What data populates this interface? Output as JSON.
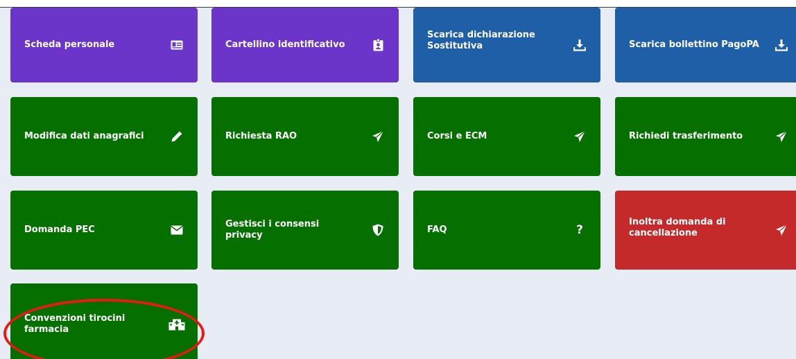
{
  "tiles": [
    {
      "id": "scheda-personale",
      "label": "Scheda personale",
      "icon": "id-card-icon",
      "color": "#6a35c8"
    },
    {
      "id": "cartellino-identificativo",
      "label": "Cartellino identificativo",
      "icon": "badge-icon",
      "color": "#6a35c8"
    },
    {
      "id": "scarica-dichiarazione",
      "label": "Scarica dichiarazione Sostitutiva",
      "icon": "download-icon",
      "color": "#1f5fa8"
    },
    {
      "id": "scarica-bollettino",
      "label": "Scarica bollettino PagoPA",
      "icon": "download-icon",
      "color": "#1f5fa8"
    },
    {
      "id": "modifica-dati",
      "label": "Modifica dati anagrafici",
      "icon": "pencil-icon",
      "color": "#057000"
    },
    {
      "id": "richiesta-rao",
      "label": "Richiesta RAO",
      "icon": "send-icon",
      "color": "#057000"
    },
    {
      "id": "corsi-ecm",
      "label": "Corsi e ECM",
      "icon": "send-icon",
      "color": "#057000"
    },
    {
      "id": "richiedi-trasferimento",
      "label": "Richiedi trasferimento",
      "icon": "send-icon",
      "color": "#057000"
    },
    {
      "id": "domanda-pec",
      "label": "Domanda PEC",
      "icon": "envelope-icon",
      "color": "#057000"
    },
    {
      "id": "gestisci-consensi",
      "label": "Gestisci i consensi privacy",
      "icon": "shield-icon",
      "color": "#057000"
    },
    {
      "id": "faq",
      "label": "FAQ",
      "icon": "question-icon",
      "color": "#057000"
    },
    {
      "id": "inoltra-cancellazione",
      "label": "Inoltra domanda di cancellazione",
      "icon": "send-icon",
      "color": "#c42a2a"
    },
    {
      "id": "convenzioni-tirocini",
      "label": "Convenzioni tirocini farmacia",
      "icon": "hospital-icon",
      "color": "#057000"
    }
  ],
  "faq_glyph": "?",
  "annotation": {
    "color": "#e81818",
    "target": "convenzioni-tirocini"
  }
}
